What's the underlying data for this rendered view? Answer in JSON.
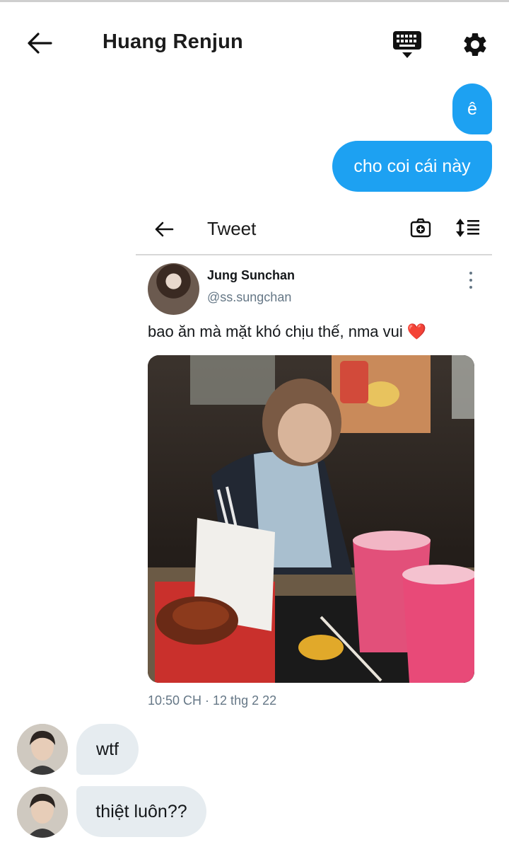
{
  "header": {
    "title": "Huang Renjun",
    "back_icon": "arrow-left-icon",
    "keyboard_icon": "keyboard-hide-icon",
    "settings_icon": "gear-icon"
  },
  "messages": {
    "sent": [
      "ê",
      "cho coi cái này"
    ],
    "received": [
      "wtf",
      "thiệt luôn??"
    ]
  },
  "tweet": {
    "bar_title": "Tweet",
    "author_name": "Jung Sunchan",
    "author_handle": "@ss.sungchan",
    "text": "bao ăn mà mặt khó chịu thế, nma vui",
    "emoji": "❤️",
    "timestamp": "10:50 CH · 12 thg 2 22"
  },
  "colors": {
    "accent": "#1da1f2",
    "received_bubble": "#e6ecf0",
    "muted_text": "#657786"
  }
}
